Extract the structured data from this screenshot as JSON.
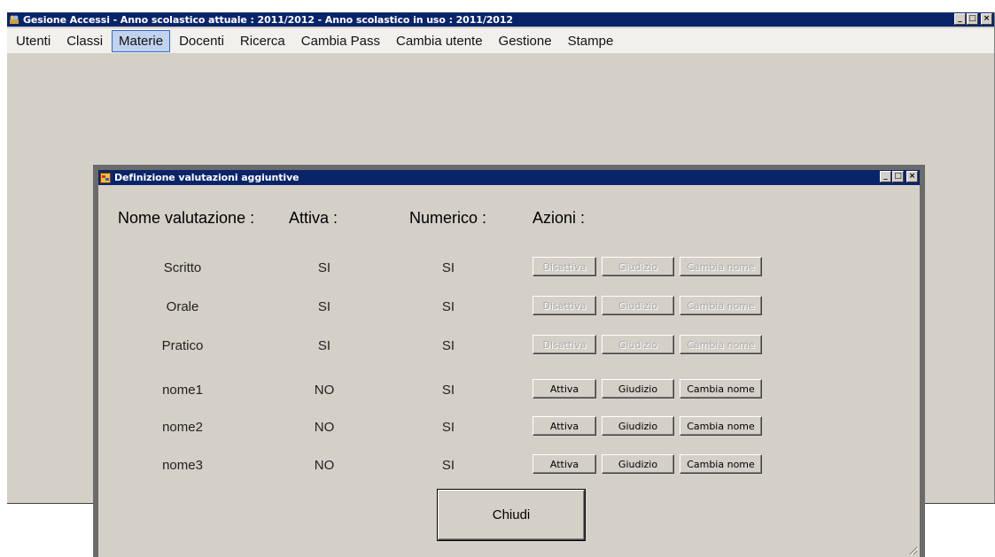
{
  "main_window": {
    "title": "Gesione Accessi - Anno scolastico attuale : 2011/2012 - Anno scolastico in uso : 2011/2012",
    "controls": {
      "minimize": "_",
      "maximize": "□",
      "close": "×"
    }
  },
  "menu": {
    "items": [
      "Utenti",
      "Classi",
      "Materie",
      "Docenti",
      "Ricerca",
      "Cambia Pass",
      "Cambia utente",
      "Gestione",
      "Stampe"
    ],
    "active": "Materie"
  },
  "dialog": {
    "title": "Definizione valutazioni aggiuntive",
    "headers": {
      "name": "Nome valutazione :",
      "active": "Attiva :",
      "numeric": "Numerico :",
      "actions": "Azioni :"
    },
    "rows": [
      {
        "name": "Scritto",
        "active": "SI",
        "numeric": "SI",
        "toggle_label": "Disattiva",
        "judgement_label": "Giudizio",
        "rename_label": "Cambia nome",
        "enabled": false
      },
      {
        "name": "Orale",
        "active": "SI",
        "numeric": "SI",
        "toggle_label": "Disattiva",
        "judgement_label": "Giudizio",
        "rename_label": "Cambia nome",
        "enabled": false
      },
      {
        "name": "Pratico",
        "active": "SI",
        "numeric": "SI",
        "toggle_label": "Disattiva",
        "judgement_label": "Giudizio",
        "rename_label": "Cambia nome",
        "enabled": false
      },
      {
        "name": "nome1",
        "active": "NO",
        "numeric": "SI",
        "toggle_label": "Attiva",
        "judgement_label": "Giudizio",
        "rename_label": "Cambia nome",
        "enabled": true
      },
      {
        "name": "nome2",
        "active": "NO",
        "numeric": "SI",
        "toggle_label": "Attiva",
        "judgement_label": "Giudizio",
        "rename_label": "Cambia nome",
        "enabled": true
      },
      {
        "name": "nome3",
        "active": "NO",
        "numeric": "SI",
        "toggle_label": "Attiva",
        "judgement_label": "Giudizio",
        "rename_label": "Cambia nome",
        "enabled": true
      }
    ],
    "close_label": "Chiudi",
    "controls": {
      "minimize": "_",
      "maximize": "□",
      "close": "×"
    }
  },
  "colors": {
    "titlebar": "#0a246a",
    "face": "#d4d0c8",
    "menu_highlight": "#c1d2ee"
  }
}
